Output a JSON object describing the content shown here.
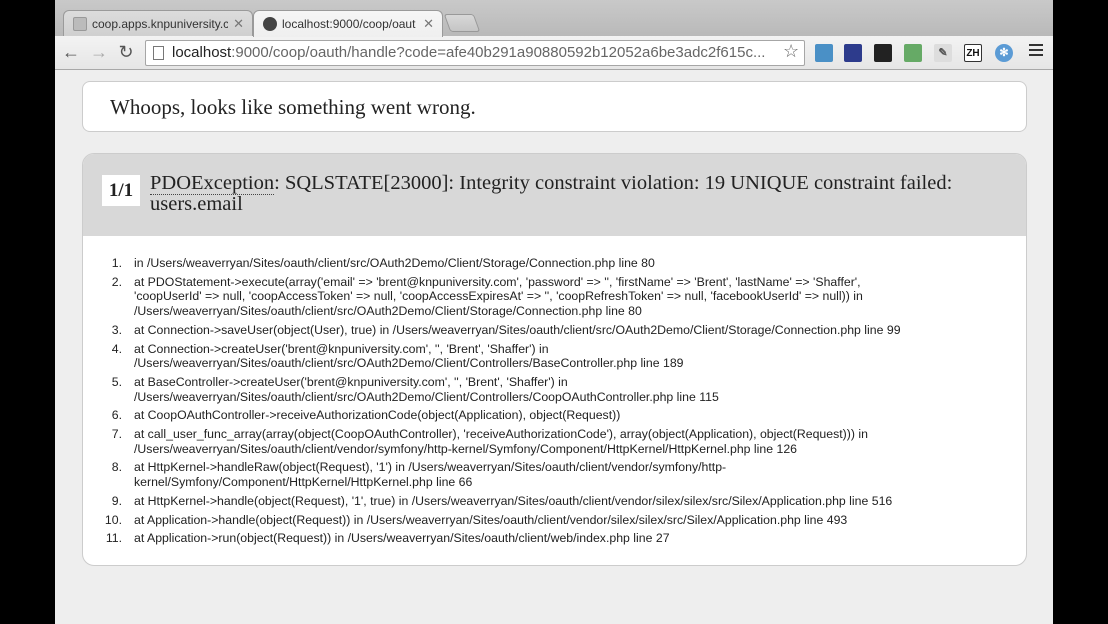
{
  "tabs": [
    {
      "title": "coop.apps.knpuniversity.c",
      "active": false
    },
    {
      "title": "localhost:9000/coop/oaut",
      "active": true
    }
  ],
  "address": {
    "host": "localhost",
    "path": ":9000/coop/oauth/handle?code=afe40b291a90880592b12052a6be3adc2f615c..."
  },
  "extensions": [
    "bird-icon",
    "badge-icon",
    "terminal-icon",
    "dropper-icon",
    "scribble-icon",
    "zh-icon",
    "snowflake-icon"
  ],
  "ext_zh_label": "ZH",
  "page": {
    "whoops": "Whoops, looks like something went wrong.",
    "count": "1/1",
    "exception_class": "PDOException",
    "exception_message": ": SQLSTATE[23000]: Integrity constraint violation: 19 UNIQUE constraint failed: users.email"
  },
  "trace": [
    {
      "n": "1.",
      "lines": [
        "in /Users/weaverryan/Sites/oauth/client/src/OAuth2Demo/Client/Storage/Connection.php line 80"
      ]
    },
    {
      "n": "2.",
      "lines": [
        "at PDOStatement->execute(array('email' => 'brent@knpuniversity.com', 'password' => '', 'firstName' => 'Brent', 'lastName' => 'Shaffer',",
        "'coopUserId' => null, 'coopAccessToken' => null, 'coopAccessExpiresAt' => '', 'coopRefreshToken' => null, 'facebookUserId' => null)) in",
        "/Users/weaverryan/Sites/oauth/client/src/OAuth2Demo/Client/Storage/Connection.php line 80"
      ]
    },
    {
      "n": "3.",
      "lines": [
        "at Connection->saveUser(object(User), true) in /Users/weaverryan/Sites/oauth/client/src/OAuth2Demo/Client/Storage/Connection.php line 99"
      ]
    },
    {
      "n": "4.",
      "lines": [
        "at Connection->createUser('brent@knpuniversity.com', '', 'Brent', 'Shaffer') in",
        "/Users/weaverryan/Sites/oauth/client/src/OAuth2Demo/Client/Controllers/BaseController.php line 189"
      ]
    },
    {
      "n": "5.",
      "lines": [
        "at BaseController->createUser('brent@knpuniversity.com', '', 'Brent', 'Shaffer') in",
        "/Users/weaverryan/Sites/oauth/client/src/OAuth2Demo/Client/Controllers/CoopOAuthController.php line 115"
      ]
    },
    {
      "n": "6.",
      "lines": [
        "at CoopOAuthController->receiveAuthorizationCode(object(Application), object(Request))"
      ]
    },
    {
      "n": "7.",
      "lines": [
        "at call_user_func_array(array(object(CoopOAuthController), 'receiveAuthorizationCode'), array(object(Application), object(Request))) in",
        "/Users/weaverryan/Sites/oauth/client/vendor/symfony/http-kernel/Symfony/Component/HttpKernel/HttpKernel.php line 126"
      ]
    },
    {
      "n": "8.",
      "lines": [
        "at HttpKernel->handleRaw(object(Request), '1') in /Users/weaverryan/Sites/oauth/client/vendor/symfony/http-",
        "kernel/Symfony/Component/HttpKernel/HttpKernel.php line 66"
      ]
    },
    {
      "n": "9.",
      "lines": [
        "at HttpKernel->handle(object(Request), '1', true) in /Users/weaverryan/Sites/oauth/client/vendor/silex/silex/src/Silex/Application.php line 516"
      ]
    },
    {
      "n": "10.",
      "lines": [
        "at Application->handle(object(Request)) in /Users/weaverryan/Sites/oauth/client/vendor/silex/silex/src/Silex/Application.php line 493"
      ]
    },
    {
      "n": "11.",
      "lines": [
        "at Application->run(object(Request)) in /Users/weaverryan/Sites/oauth/client/web/index.php line 27"
      ]
    }
  ]
}
